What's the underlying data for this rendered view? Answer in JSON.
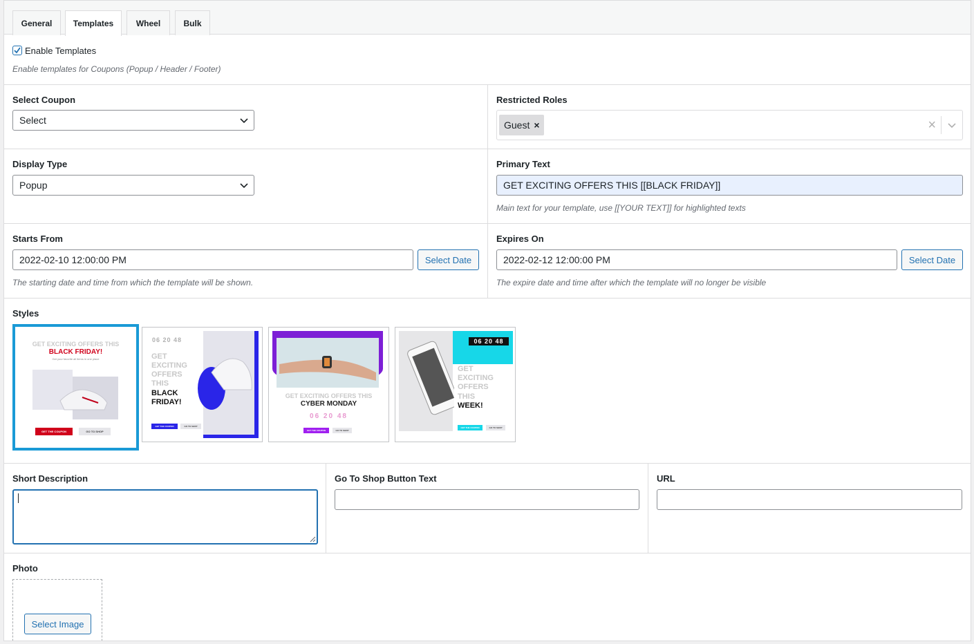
{
  "tabs": [
    {
      "label": "General"
    },
    {
      "label": "Templates"
    },
    {
      "label": "Wheel"
    },
    {
      "label": "Bulk"
    }
  ],
  "enable": {
    "label": "Enable Templates",
    "checked": true,
    "hint": "Enable templates for Coupons (Popup / Header / Footer)"
  },
  "select_coupon": {
    "label": "Select Coupon",
    "value": "Select"
  },
  "restricted_roles": {
    "label": "Restricted Roles",
    "tag": "Guest",
    "tag_remove": "×",
    "clear": "×"
  },
  "display_type": {
    "label": "Display Type",
    "value": "Popup"
  },
  "primary_text": {
    "label": "Primary Text",
    "value": "GET EXCITING OFFERS THIS [[BLACK FRIDAY]]",
    "hint": "Main text for your template, use [[YOUR TEXT]] for highlighted texts"
  },
  "starts_from": {
    "label": "Starts From",
    "value": "2022-02-10 12:00:00 PM",
    "button": "Select Date",
    "hint": "The starting date and time from which the template will be shown."
  },
  "expires_on": {
    "label": "Expires On",
    "value": "2022-02-12 12:00:00 PM",
    "button": "Select Date",
    "hint": "The expire date and time after which the template will no longer be visible"
  },
  "styles": {
    "label": "Styles",
    "selected_index": 0,
    "t1": {
      "line1": "GET EXCITING OFFERS THIS",
      "line2": "BLACK FRIDAY!",
      "line3": "Get your favorite all items in one place",
      "btn1": "GET THE COUPON",
      "btn2": "GO TO SHOP"
    },
    "t2": {
      "timer": "06 20 48",
      "w1": "GET",
      "w2": "EXCITING",
      "w3": "OFFERS",
      "w4": "THIS",
      "w5": "BLACK",
      "w6": "FRIDAY!",
      "btn1": "GET THE COUPON",
      "btn2": "GO TO SHOP"
    },
    "t3": {
      "line1": "GET EXCITING OFFERS THIS",
      "line2": "CYBER MONDAY",
      "timer": "06 20 48",
      "btn1": "GET THE COUPON",
      "btn2": "GO TO SHOP"
    },
    "t4": {
      "timer": "06 20 48",
      "w1": "GET",
      "w2": "EXCITING",
      "w3": "OFFERS",
      "w4": "THIS",
      "w5": "WEEK!",
      "btn1": "GET THE COUPON",
      "btn2": "GO TO SHOP"
    },
    "colors": {
      "selected_border": "#1a9ad6",
      "red": "#d0021b",
      "blue": "#3a1cff",
      "purple": "#a020f0",
      "cyan": "#17d7e8"
    }
  },
  "short_description": {
    "label": "Short Description",
    "value": ""
  },
  "go_to_shop": {
    "label": "Go To Shop Button Text",
    "value": ""
  },
  "url": {
    "label": "URL",
    "value": ""
  },
  "photo": {
    "label": "Photo",
    "button": "Select Image"
  }
}
